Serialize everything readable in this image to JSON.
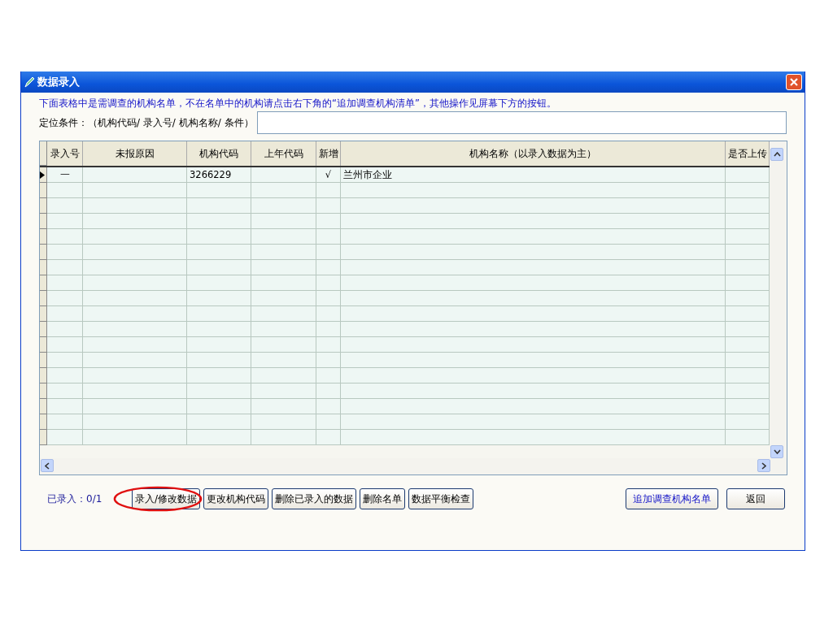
{
  "window": {
    "title": "数据录入"
  },
  "instruction": "下面表格中是需调查的机构名单，不在名单中的机构请点击右下角的“追加调查机构清单”，其他操作见屏幕下方的按钮。",
  "locate": {
    "label": "定位条件：（机构代码/ 录入号/ 机构名称/ 条件）"
  },
  "table": {
    "columns": [
      "录入号",
      "未报原因",
      "机构代码",
      "上年代码",
      "新增",
      "机构名称（以录入数据为主）",
      "是否上传"
    ],
    "rows": [
      {
        "selected": true,
        "cells": [
          "一",
          "",
          "3266229",
          "",
          "√",
          "兰州市企业",
          ""
        ]
      }
    ]
  },
  "status": "已录入：0/1",
  "buttons": [
    {
      "label": "录入/修改数据",
      "highlighted": true
    },
    {
      "label": "更改机构代码",
      "highlighted": false
    },
    {
      "label": "删除已录入的数据",
      "highlighted": false
    },
    {
      "label": "删除名单",
      "highlighted": false
    },
    {
      "label": "数据平衡检查",
      "highlighted": false
    }
  ],
  "right_buttons": [
    {
      "label": "追加调查机构名单",
      "kind": "link"
    },
    {
      "label": "返回",
      "kind": "plain"
    }
  ]
}
